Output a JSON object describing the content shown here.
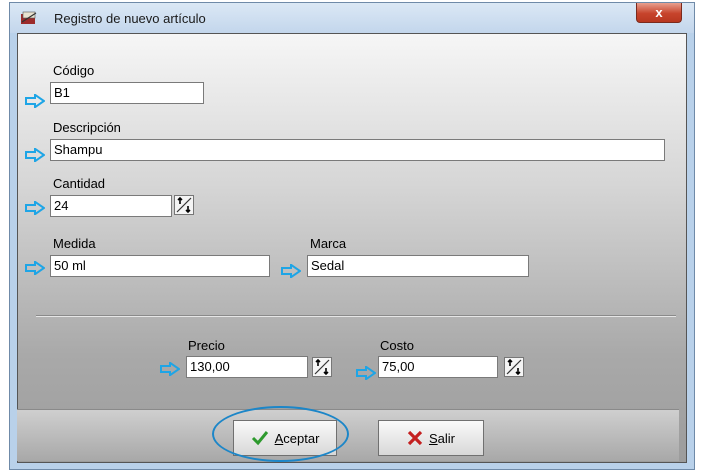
{
  "window": {
    "title": "Registro de nuevo artículo",
    "close_label": "x"
  },
  "form": {
    "codigo": {
      "label": "Código",
      "value": "B1"
    },
    "descripcion": {
      "label": "Descripción",
      "value": "Shampu"
    },
    "cantidad": {
      "label": "Cantidad",
      "value": "24"
    },
    "medida": {
      "label": "Medida",
      "value": "50 ml"
    },
    "marca": {
      "label": "Marca",
      "value": "Sedal"
    },
    "precio": {
      "label": "Precio",
      "value": "130,00"
    },
    "costo": {
      "label": "Costo",
      "value": "75,00"
    }
  },
  "buttons": {
    "aceptar": "Aceptar",
    "salir": "Salir"
  },
  "colors": {
    "arrow": "#1ea5e6",
    "highlight_oval": "#1c86c8",
    "close_button": "#c7442c"
  },
  "icons": [
    "app-icon",
    "arrow-right-icon",
    "spinner-icon",
    "check-icon",
    "x-icon"
  ]
}
